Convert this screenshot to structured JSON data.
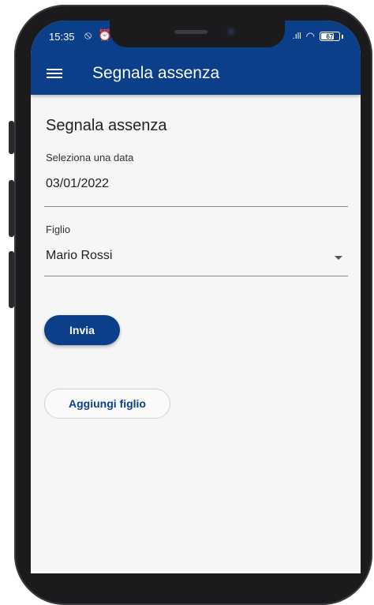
{
  "status_bar": {
    "time": "15:35",
    "left_icons": "⦸ ⏰",
    "battery": "67"
  },
  "app_bar": {
    "title": "Segnala assenza",
    "menu_icon": "hamburger-menu-icon"
  },
  "form": {
    "title": "Segnala assenza",
    "date_field": {
      "label": "Seleziona una data",
      "value": "03/01/2022"
    },
    "child_field": {
      "label": "Figlio",
      "value": "Mario Rossi"
    },
    "submit_label": "Invia",
    "add_child_label": "Aggiungi figlio"
  },
  "colors": {
    "primary": "#0b3f8a",
    "background": "#f6f6f6"
  }
}
